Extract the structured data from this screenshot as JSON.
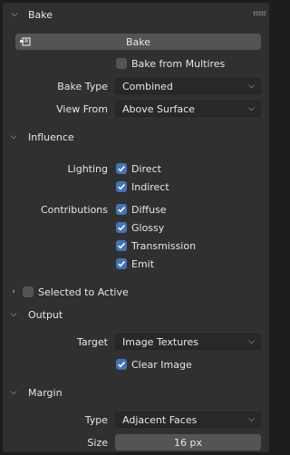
{
  "panel": {
    "title": "Bake"
  },
  "bake_button": {
    "label": "Bake"
  },
  "bake_from_multires": {
    "label": "Bake from Multires",
    "checked": false
  },
  "bake_type": {
    "label": "Bake Type",
    "value": "Combined"
  },
  "view_from": {
    "label": "View From",
    "value": "Above Surface"
  },
  "influence": {
    "title": "Influence",
    "lighting_label": "Lighting",
    "direct": {
      "label": "Direct",
      "checked": true
    },
    "indirect": {
      "label": "Indirect",
      "checked": true
    },
    "contributions_label": "Contributions",
    "diffuse": {
      "label": "Diffuse",
      "checked": true
    },
    "glossy": {
      "label": "Glossy",
      "checked": true
    },
    "transmission": {
      "label": "Transmission",
      "checked": true
    },
    "emit": {
      "label": "Emit",
      "checked": true
    }
  },
  "selected_to_active": {
    "label": "Selected to Active",
    "checked": false
  },
  "output": {
    "title": "Output",
    "target_label": "Target",
    "target_value": "Image Textures",
    "clear_image": {
      "label": "Clear Image",
      "checked": true
    }
  },
  "margin": {
    "title": "Margin",
    "type_label": "Type",
    "type_value": "Adjacent Faces",
    "size_label": "Size",
    "size_value": "16 px"
  },
  "colors": {
    "accent": "#4772b3",
    "panel": "#303030",
    "background": "#1d1d1d"
  },
  "icons": [
    "chevron-down-icon",
    "chevron-right-icon",
    "drag-handle-icon",
    "render-bake-icon",
    "checkmark-icon"
  ]
}
